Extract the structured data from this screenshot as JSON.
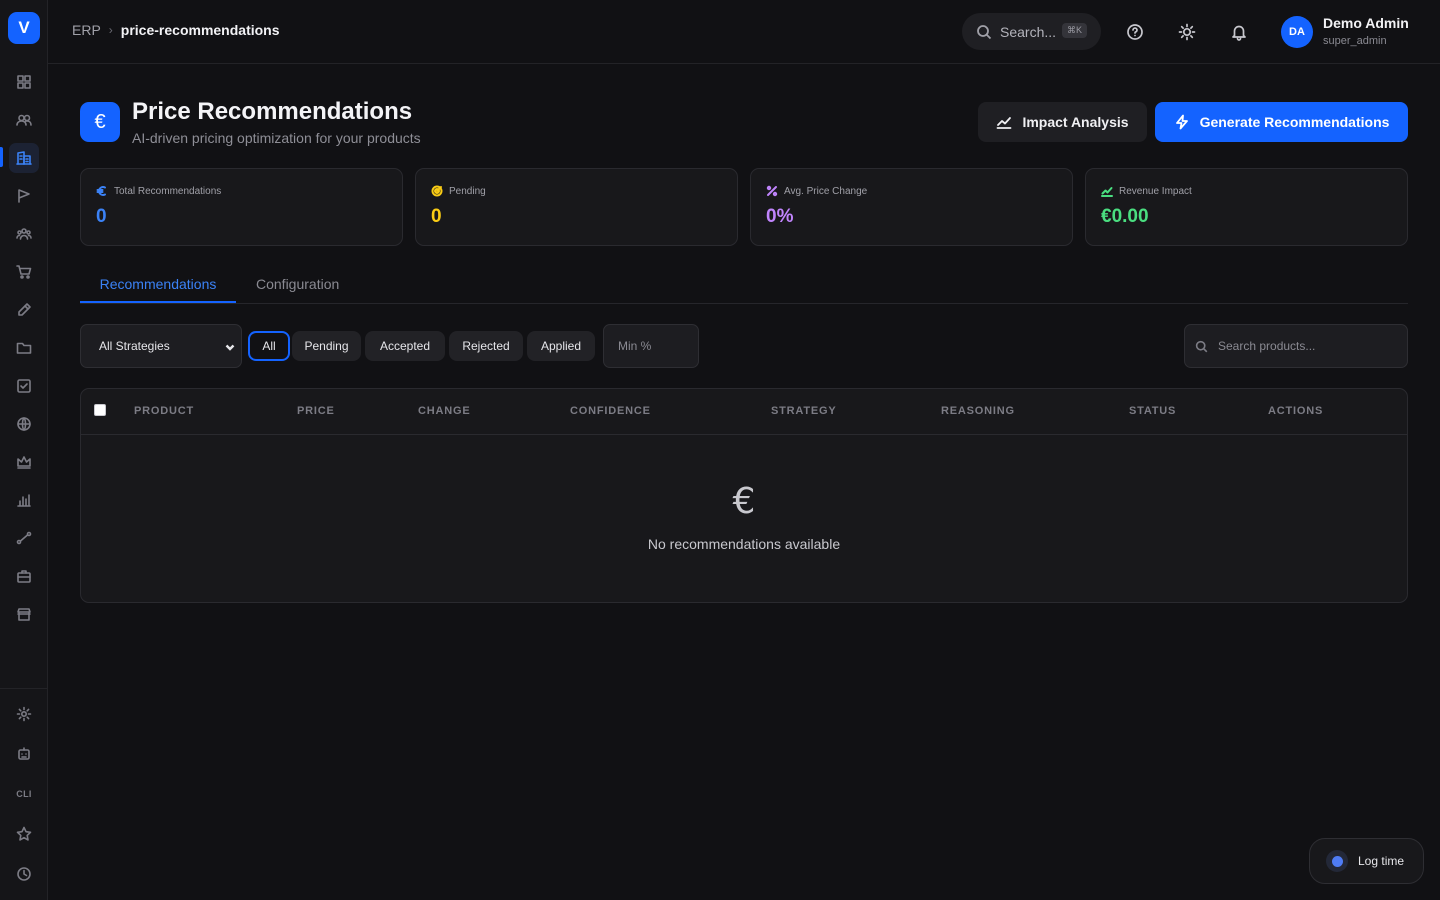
{
  "app": {
    "logo_letter": "V"
  },
  "breadcrumb": {
    "root": "ERP",
    "separator": "›",
    "current": "price-recommendations"
  },
  "topbar": {
    "search_placeholder": "Search...",
    "search_shortcut": "⌘K",
    "user": {
      "initials": "DA",
      "name": "Demo Admin",
      "role": "super_admin"
    }
  },
  "header": {
    "icon_glyph": "€",
    "title": "Price Recommendations",
    "subtitle": "AI-driven pricing optimization for your products",
    "impact_button": "Impact Analysis",
    "generate_button": "Generate Recommendations"
  },
  "stats": [
    {
      "label": "Total Recommendations",
      "value": "0",
      "icon": "euro-icon",
      "color": "#3b82f6"
    },
    {
      "label": "Pending",
      "value": "0",
      "icon": "target-icon",
      "color": "#facc15"
    },
    {
      "label": "Avg. Price Change",
      "value": "0%",
      "icon": "percent-icon",
      "color": "#c084fc"
    },
    {
      "label": "Revenue Impact",
      "value": "€0.00",
      "icon": "trending-up-icon",
      "color": "#4ade80"
    }
  ],
  "tabs": {
    "active": "Recommendations",
    "inactive": "Configuration"
  },
  "filters": {
    "strategy_selected": "All Strategies",
    "chips": [
      "All",
      "Pending",
      "Accepted",
      "Rejected",
      "Applied"
    ],
    "active_chip": "All",
    "min_percent_placeholder": "Min %",
    "search_placeholder": "Search products..."
  },
  "table": {
    "columns": [
      "PRODUCT",
      "PRICE",
      "CHANGE",
      "CONFIDENCE",
      "STRATEGY",
      "REASONING",
      "STATUS",
      "ACTIONS"
    ],
    "empty_icon": "€",
    "empty_message": "No recommendations available"
  },
  "sidebar": {
    "bottom_label": "CLI"
  },
  "floating": {
    "log_time_label": "Log time"
  },
  "colors": {
    "accent": "#1463ff",
    "background": "#111114",
    "card": "#18181b"
  }
}
